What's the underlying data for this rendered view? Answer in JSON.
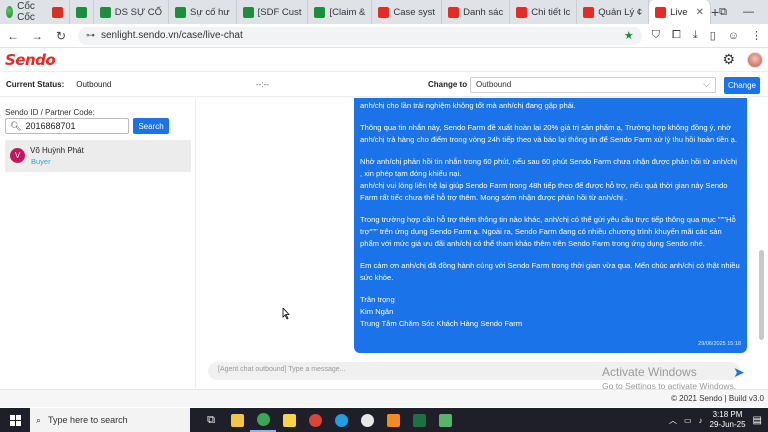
{
  "browser": {
    "name": "Cốc Cốc",
    "tabs": [
      {
        "label": "",
        "icon": "gmail-icon",
        "color": "#d93025"
      },
      {
        "label": "",
        "icon": "sheets-icon",
        "color": "#1e8e3e"
      },
      {
        "label": "DS SỰ CỐ",
        "icon": "sheets-icon",
        "color": "#1e8e3e"
      },
      {
        "label": "Sự cố hư",
        "icon": "sheets-icon",
        "color": "#1e8e3e"
      },
      {
        "label": "[SDF Cust",
        "icon": "sheets-icon",
        "color": "#1e8e3e"
      },
      {
        "label": "[Claim &",
        "icon": "sheets-icon",
        "color": "#1e8e3e"
      },
      {
        "label": "Case syst",
        "icon": "sendo-icon",
        "color": "#e52a28"
      },
      {
        "label": "Danh sác",
        "icon": "sendo-icon",
        "color": "#e52a28"
      },
      {
        "label": "Chi tiết lc",
        "icon": "sendo-icon",
        "color": "#e52a28"
      },
      {
        "label": "Quản Lý ¢",
        "icon": "sendo-icon",
        "color": "#e52a28"
      },
      {
        "label": "Live",
        "icon": "sendo-icon",
        "color": "#e52a28",
        "active": true
      }
    ],
    "url": "senlight.sendo.vn/case/live-chat"
  },
  "app": {
    "logo": "Sendo"
  },
  "status": {
    "current_label": "Current Status:",
    "current_value": "Outbound",
    "timer": "--:--",
    "change_to_label": "Change to",
    "change_to_value": "Outbound",
    "change_button": "Change"
  },
  "left": {
    "search_label": "Sendo ID / Partner Code:",
    "search_value": "2016868701",
    "search_button": "Search",
    "contact": {
      "initial": "V",
      "name": "Võ Huỳnh Phát",
      "role": "Buyer"
    }
  },
  "chat": {
    "message": {
      "p1": "anh/chị cho lần trải nghiệm không tốt mà anh/chị đang gặp phải.",
      "p2": "Thông qua tin nhắn này, Sendo Farm đề xuất hoàn lại 20% giá trị sản phẩm ạ, Trường hợp không đồng ý, nhờ anh/chị trả hàng cho điểm trong vòng 24h tiếp theo và báo lại thông tin để Sendo Farm xử lý thu hồi hoàn tiền ạ.",
      "p3a": "Nhờ anh/chị phản hồi tin nhắn trong 60 phút, nếu sau 60 phút Sendo Farm chưa nhận được phản hồi từ anh/chị , xin phép tạm đóng khiếu nại.",
      "p3b": "anh/chị vui lòng liên hệ lại giúp Sendo Farm trong 48h tiếp theo để được hỗ trợ, nếu quá thời gian này Sendo Farm rất tiếc chưa thể hỗ trợ thêm. Mong sớm nhận được phản hồi từ anh/chị .",
      "p4": "Trong trường hợp cần hỗ trợ thêm thông tin nào khác, anh/chị có thể gửi yêu cầu trực tiếp thông qua mục \"\"\"Hỗ trợ\"\"\" trên ứng dụng Sendo Farm ạ. Ngoài ra, Sendo Farm đang có nhiều chương trình khuyến mãi các sản phẩm với mức giá ưu đãi anh/chị có thể tham khảo thêm trên Sendo Farm trong ứng dụng Sendo nhé.",
      "p5": "Em cảm ơn anh/chị đã đồng hành cùng với Sendo Farm trong thời gian vừa qua. Mến chúc anh/chị có thật nhiều sức khỏe.",
      "sig1": "Trân trọng",
      "sig2": "Kim Ngân",
      "sig3": "Trung Tâm Chăm Sóc Khách Hàng Sendo Farm",
      "timestamp": "29/06/2025 15:18"
    },
    "input_placeholder": "[Agent chat outbound] Type a message...",
    "watermark_title": "Activate Windows",
    "watermark_sub": "Go to Settings to activate Windows."
  },
  "footer": {
    "text": "© 2021 Sendo | Build v3.0"
  },
  "taskbar": {
    "search_placeholder": "Type here to search",
    "time": "3:18 PM",
    "date": "29-Jun-25"
  }
}
